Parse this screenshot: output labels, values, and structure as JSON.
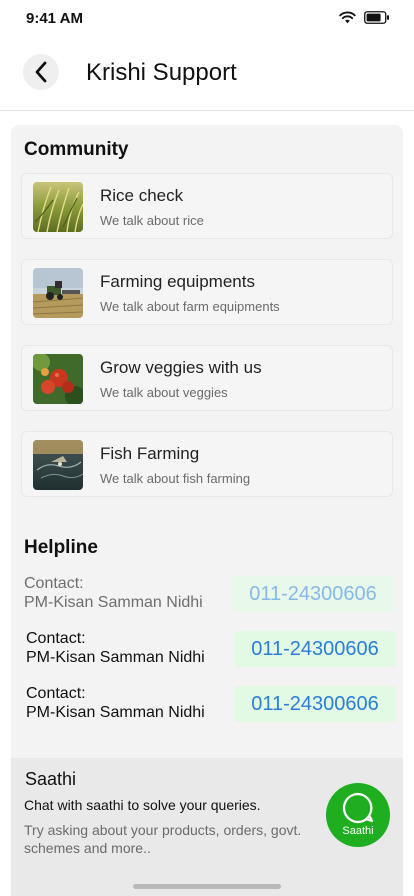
{
  "status_bar": {
    "time": "9:41 AM",
    "icons": [
      "wifi-icon",
      "battery-icon"
    ]
  },
  "header": {
    "title": "Krishi Support",
    "back_icon": "chevron-left-icon"
  },
  "community": {
    "title": "Community",
    "items": [
      {
        "title": "Rice check",
        "subtitle": "We talk about rice",
        "image": "rice-field-image"
      },
      {
        "title": "Farming equipments",
        "subtitle": "We talk about farm equipments",
        "image": "tractor-image"
      },
      {
        "title": "Grow veggies with us",
        "subtitle": "We talk about veggies",
        "image": "tomatoes-image"
      },
      {
        "title": "Fish Farming",
        "subtitle": "We talk about fish farming",
        "image": "fish-pond-image"
      }
    ]
  },
  "helpline": {
    "title": "Helpline",
    "rows": [
      {
        "label1": "Contact:",
        "label2": "PM-Kisan Samman Nidhi",
        "phone": "011-24300606"
      },
      {
        "label1": "Contact:",
        "label2": "PM-Kisan Samman Nidhi",
        "phone": "011-24300606"
      },
      {
        "label1": "Contact:",
        "label2": "PM-Kisan Samman Nidhi",
        "phone": "011-24300606"
      }
    ]
  },
  "saathi": {
    "title": "Saathi",
    "description": "Chat with saathi to solve your queries.",
    "hint": "Try asking about your products, orders, govt. schemes and more..",
    "button_label": "Saathi",
    "accent": "#1fae1f"
  },
  "colors": {
    "phone_bg": "#e2f9e4",
    "phone_text": "#2a7fd6",
    "panel_bg": "#f3f3f3"
  }
}
